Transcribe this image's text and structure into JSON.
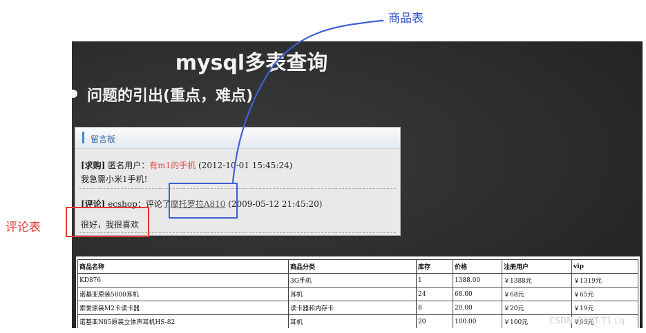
{
  "slide": {
    "title": "mysql多表查询",
    "subtitle": "问题的引出(重点，难点)"
  },
  "message_board": {
    "title": "留言板",
    "entry1": {
      "tag": "[求购]",
      "user": "匿名用户：",
      "product": "有m1的手机",
      "time": "(2012-10-01 15:45:24)",
      "content": "我急需小米1手机!"
    },
    "entry2": {
      "tag": "[评论]",
      "user": "ecshop：评论了",
      "product": "摩托罗拉A810",
      "time": "(2009-05-12 21:45:20)",
      "content": "很好，我很喜欢"
    }
  },
  "goods_table": {
    "headers": [
      "商品名称",
      "商品分类",
      "库存",
      "价格",
      "注册用户",
      "vip"
    ],
    "rows": [
      [
        "KD876",
        "3G手机",
        "1",
        "1388.00",
        "￥1388元",
        "￥1319元"
      ],
      [
        "诺基亚原装5800耳机",
        "耳机",
        "24",
        "68.00",
        "￥68元",
        "￥65元"
      ],
      [
        "索爱原装M2卡读卡器",
        "读卡器和内存卡",
        "8",
        "20.00",
        "￥20元",
        "￥19元"
      ],
      [
        "诺基亚N85原装立体声耳机HS-82",
        "耳机",
        "20",
        "100.00",
        "￥100元",
        "￥95元"
      ]
    ]
  },
  "annotations": {
    "comment_table_label": "评论表",
    "goods_table_label": "商品表",
    "box_red": "#e53935",
    "box_blue": "#3f5fd6"
  },
  "watermark": "CSDN @SKT T1 Lq"
}
